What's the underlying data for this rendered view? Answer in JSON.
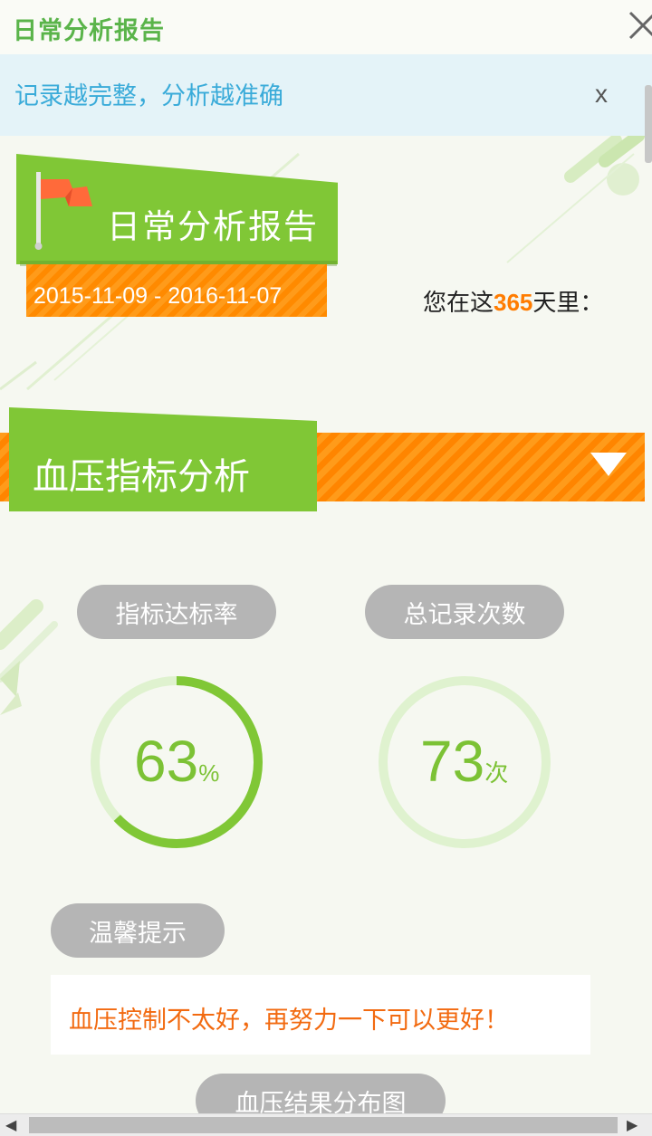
{
  "window": {
    "title": "日常分析报告",
    "close_icon": "close-icon"
  },
  "notice": {
    "text": "记录越完整，分析越准确",
    "dismiss_label": "x"
  },
  "report": {
    "title": "日常分析报告",
    "date_range": "2015-11-09 - 2016-11-07",
    "days_prefix": "您在这",
    "days_count": "365",
    "days_suffix": "天里："
  },
  "section": {
    "title": "血压指标分析",
    "toggle_icon": "triangle-down-icon"
  },
  "metrics": {
    "rate_label": "指标达标率",
    "rate_value": "63",
    "rate_unit": "%",
    "rate_fraction": 0.63,
    "count_label": "总记录次数",
    "count_value": "73",
    "count_unit": "次"
  },
  "tips": {
    "label": "温馨提示",
    "message": "血压控制不太好，再努力一下可以更好！"
  },
  "distribution": {
    "label": "血压结果分布图"
  },
  "colors": {
    "green": "#80c736",
    "orange": "#ff8a00",
    "ring_track": "#dff2cf",
    "tip_text": "#f26a10"
  }
}
